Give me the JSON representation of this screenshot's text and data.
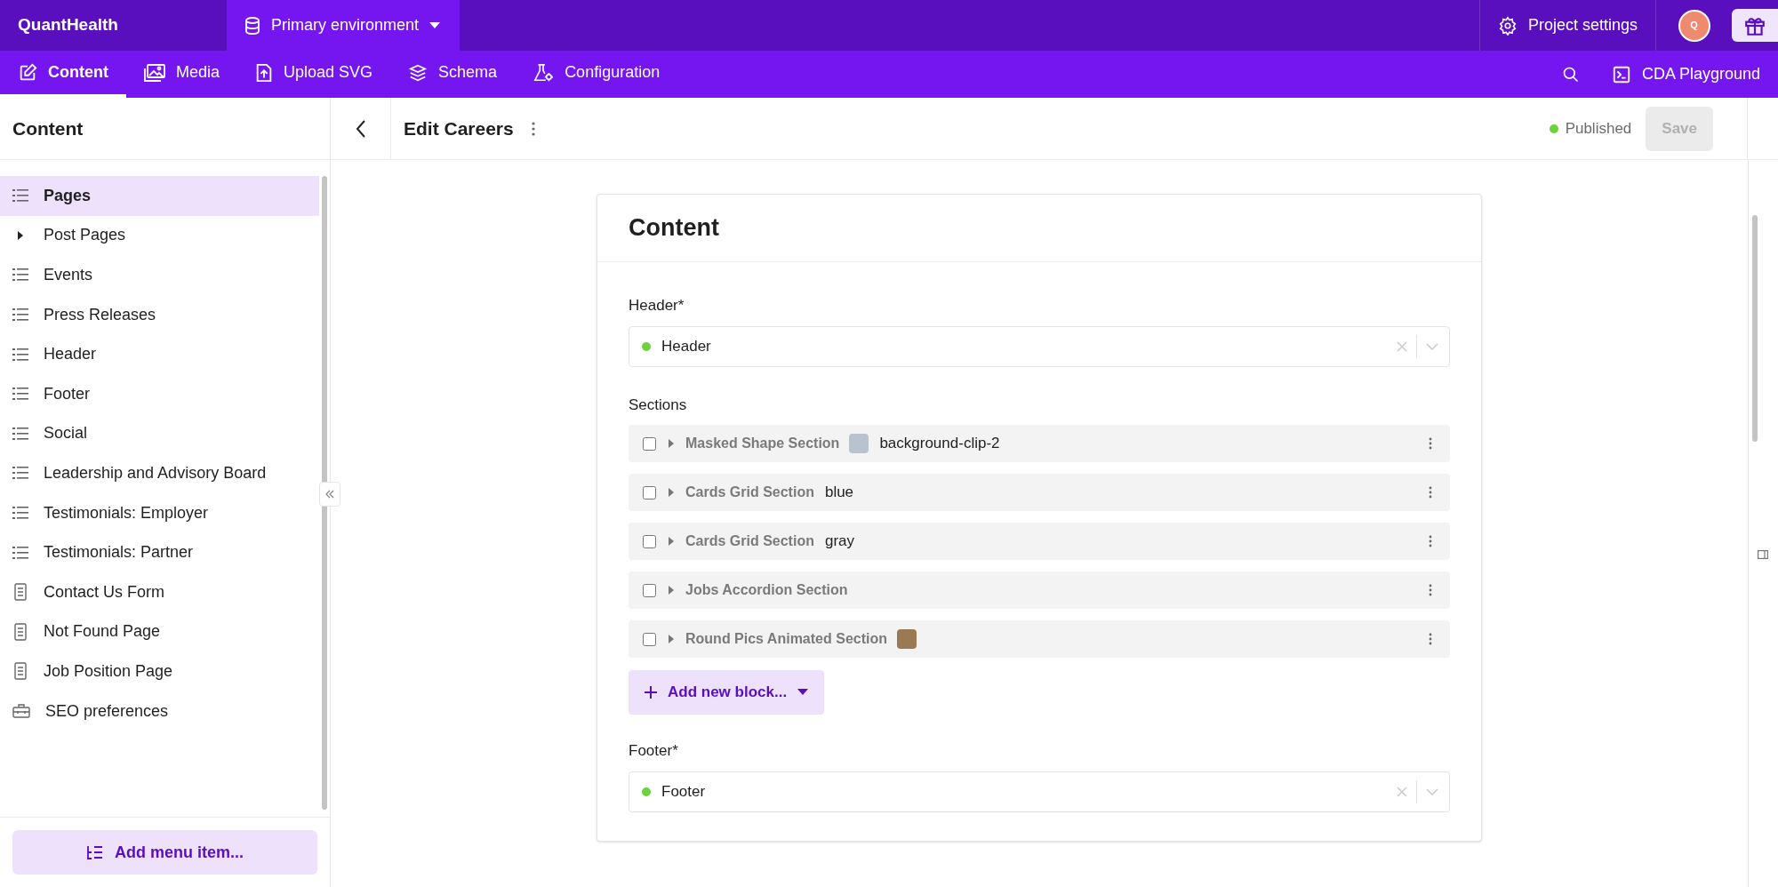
{
  "app": {
    "name": "QuantHealth",
    "environment": "Primary environment",
    "project_settings": "Project settings",
    "avatar": "Q"
  },
  "nav_tabs": [
    {
      "label": "Content",
      "selected": true
    },
    {
      "label": "Media",
      "selected": false
    },
    {
      "label": "Upload SVG",
      "selected": false
    },
    {
      "label": "Schema",
      "selected": false
    },
    {
      "label": "Configuration",
      "selected": false
    }
  ],
  "playground": "CDA Playground",
  "sidebar": {
    "title": "Content",
    "items": [
      {
        "label": "Pages",
        "kind": "list",
        "selected": true
      },
      {
        "label": "Post Pages",
        "kind": "group",
        "selected": false
      },
      {
        "label": "Events",
        "kind": "list",
        "selected": false
      },
      {
        "label": "Press Releases",
        "kind": "list",
        "selected": false
      },
      {
        "label": "Header",
        "kind": "list",
        "selected": false
      },
      {
        "label": "Footer",
        "kind": "list",
        "selected": false
      },
      {
        "label": "Social",
        "kind": "list",
        "selected": false
      },
      {
        "label": "Leadership and Advisory Board",
        "kind": "list",
        "selected": false
      },
      {
        "label": "Testimonials: Employer",
        "kind": "list",
        "selected": false
      },
      {
        "label": "Testimonials: Partner",
        "kind": "list",
        "selected": false
      },
      {
        "label": "Contact Us Form",
        "kind": "single",
        "selected": false
      },
      {
        "label": "Not Found Page",
        "kind": "single",
        "selected": false
      },
      {
        "label": "Job Position Page",
        "kind": "single",
        "selected": false
      },
      {
        "label": "SEO preferences",
        "kind": "settings",
        "selected": false
      }
    ],
    "add_button": "Add menu item..."
  },
  "editor": {
    "title": "Edit Careers",
    "status": "Published",
    "save": "Save",
    "save_disabled": true
  },
  "card": {
    "title": "Content",
    "header_field": {
      "label": "Header*",
      "value": "Header",
      "color": "#6cd33c"
    },
    "sections_label": "Sections",
    "sections": [
      {
        "type": "Masked Shape Section",
        "thumbnail": true,
        "value": "background-clip-2",
        "checked": false
      },
      {
        "type": "Cards Grid Section",
        "thumbnail": false,
        "value": "blue",
        "checked": false
      },
      {
        "type": "Cards Grid Section",
        "thumbnail": false,
        "value": "gray",
        "checked": false
      },
      {
        "type": "Jobs Accordion Section",
        "thumbnail": false,
        "checked": false
      },
      {
        "type": "Round Pics Animated Section",
        "thumbnail": true,
        "checked": false
      }
    ],
    "add_block": "Add new block...",
    "footer_field": {
      "label": "Footer*",
      "value": "Footer",
      "color": "#6cd33c"
    }
  }
}
